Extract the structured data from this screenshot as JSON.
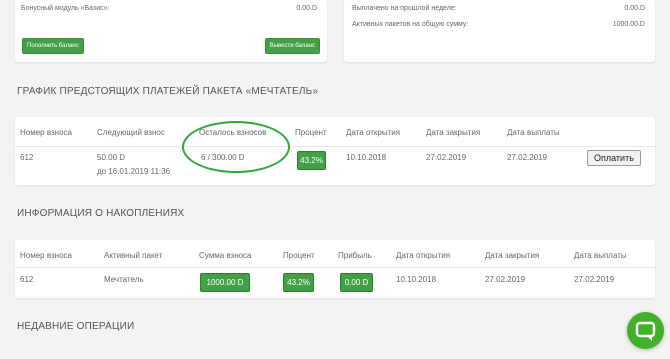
{
  "top_left": {
    "bonus_label": "Бонусный модуль «Базис»:",
    "bonus_value": "0.00 D",
    "topup_button": "Пополнить баланс",
    "withdraw_button": "Вывести баланс"
  },
  "top_right": {
    "paid_last_week_label": "Выплачено на прошлой неделе:",
    "paid_last_week_value": "0.00 D",
    "active_packages_label": "Активных пакетов на общую сумму:",
    "active_packages_value": "1000.00 D"
  },
  "payments": {
    "title": "ГРАФИК ПРЕДСТОЯЩИХ ПЛАТЕЖЕЙ ПАКЕТА «МЕЧТАТЕЛЬ»",
    "headers": [
      "Номер взноса",
      "Следующий взнос",
      "Осталось взносов",
      "Процент",
      "Дата открытия",
      "Дата закрытия",
      "Дата выплаты"
    ],
    "row": {
      "number": "612",
      "next_amount": "50.00 D",
      "next_date": "до 16.01.2019 11:36",
      "remaining": "6 / 300.00 D",
      "percent": "43.2%",
      "opened": "10.10.2018",
      "closed": "27.02.2019",
      "payout": "27.02.2019",
      "pay_button": "Оплатить"
    }
  },
  "savings": {
    "title": "ИНФОРМАЦИЯ О НАКОПЛЕНИЯХ",
    "headers": [
      "Номер взноса",
      "Активный пакет",
      "Сумма взноса",
      "Процент",
      "Прибыль",
      "Дата открытия",
      "Дата закрытия",
      "Дата выплаты"
    ],
    "row": {
      "number": "612",
      "package": "Мечтатель",
      "amount": "1000.00 D",
      "percent": "43.2%",
      "profit": "0.00 D",
      "opened": "10.10.2018",
      "closed": "27.02.2019",
      "payout": "27.02.2019"
    }
  },
  "recent": {
    "title": "НЕДАВНИЕ ОПЕРАЦИИ"
  },
  "colors": {
    "accent_green": "#43a047",
    "annotation_green": "#2fa836",
    "chat_green": "#43b02a"
  }
}
